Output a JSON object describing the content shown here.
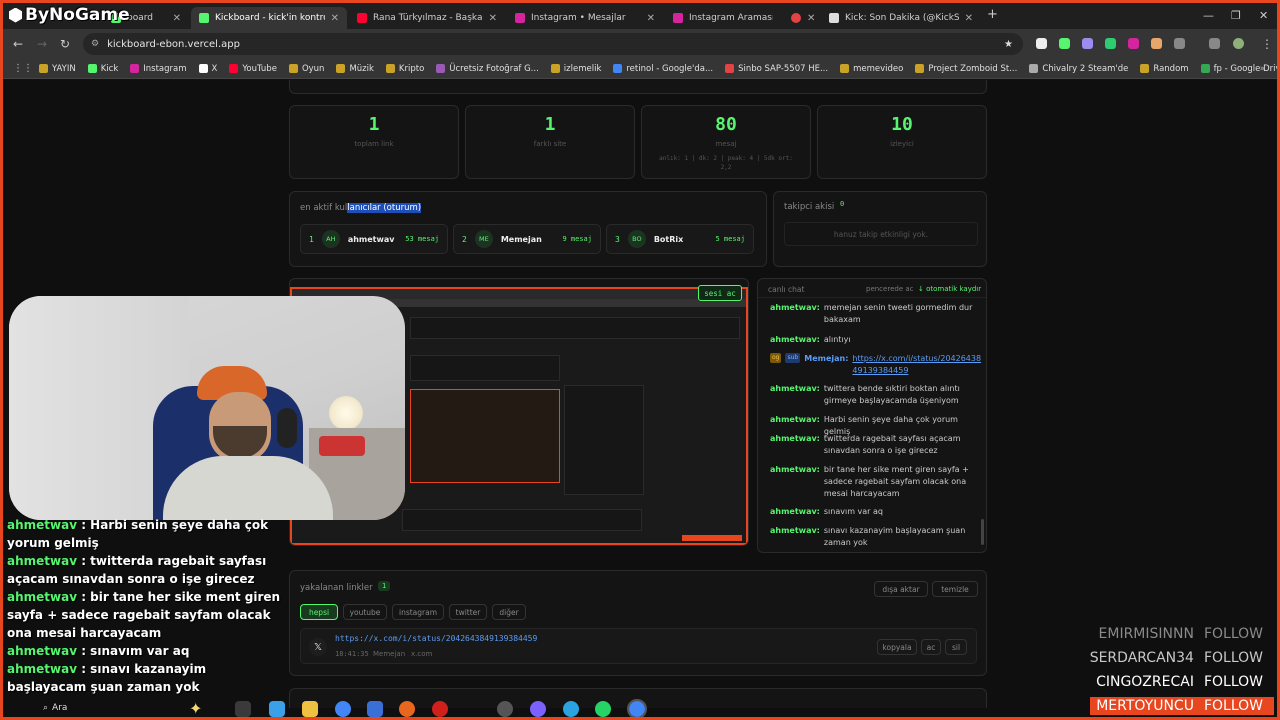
{
  "overlay": {
    "channel_logo": "ByNoGame"
  },
  "tabs": [
    {
      "label": "board",
      "active": false,
      "color": "#56f56f"
    },
    {
      "label": "Kickboard - kick'in kontrol pane",
      "active": true,
      "color": "#56f56f"
    },
    {
      "label": "Rana Türkyılmaz - Başka Hikaye",
      "active": false,
      "color": "#ff0033"
    },
    {
      "label": "Instagram • Mesajlar",
      "active": false,
      "color": "#d6249f"
    },
    {
      "label": "Instagram Araması",
      "active": false,
      "color": "#d6249f"
    },
    {
      "label": "",
      "active": false,
      "color": "#e24444"
    },
    {
      "label": "Kick: Son Dakika (@KickSonDak",
      "active": false,
      "color": "#dddddd"
    }
  ],
  "address": {
    "url": "kickboard-ebon.vercel.app"
  },
  "bookmarks": [
    {
      "label": "YAYIN",
      "color": "#c9a227"
    },
    {
      "label": "Kick",
      "color": "#56f56f"
    },
    {
      "label": "Instagram",
      "color": "#d6249f"
    },
    {
      "label": "X",
      "color": "#ffffff"
    },
    {
      "label": "YouTube",
      "color": "#ff0033"
    },
    {
      "label": "Oyun",
      "color": "#c9a227"
    },
    {
      "label": "Müzik",
      "color": "#c9a227"
    },
    {
      "label": "Kripto",
      "color": "#c9a227"
    },
    {
      "label": "Ücretsiz Fotoğraf G...",
      "color": "#9b59b6"
    },
    {
      "label": "izlemelik",
      "color": "#c9a227"
    },
    {
      "label": "retinol - Google'da...",
      "color": "#4285f4"
    },
    {
      "label": "Sinbo SAP-5507 HE...",
      "color": "#e24444"
    },
    {
      "label": "memevideo",
      "color": "#c9a227"
    },
    {
      "label": "Project Zomboid St...",
      "color": "#c9a227"
    },
    {
      "label": "Chivalry 2 Steam'de",
      "color": "#aaaaaa"
    },
    {
      "label": "Random",
      "color": "#c9a227"
    },
    {
      "label": "fp - Google Drive",
      "color": "#34a853"
    }
  ],
  "stats": [
    {
      "value": "1",
      "label": "toplam link",
      "sub": ""
    },
    {
      "value": "1",
      "label": "farklı site",
      "sub": ""
    },
    {
      "value": "80",
      "label": "mesaj",
      "sub": "anlık: 1 | dk: 2 | peak: 4 | 5dk ort: 2,2"
    },
    {
      "value": "10",
      "label": "izleyici",
      "sub": ""
    }
  ],
  "active_users": {
    "title_prefix": "en aktif kul",
    "title_selected": "lanıcılar (oturum)",
    "users": [
      {
        "rank": "1",
        "initials": "AH",
        "name": "ahmetwav",
        "count": "53 mesaj"
      },
      {
        "rank": "2",
        "initials": "ME",
        "name": "Memejan",
        "count": "9 mesaj"
      },
      {
        "rank": "3",
        "initials": "BO",
        "name": "BotRix",
        "count": "5 mesaj"
      }
    ]
  },
  "followers_panel": {
    "title": "takipci akisi",
    "count": "0",
    "empty": "hanuz takip etkinligi yok."
  },
  "stream_preview": {
    "button": "sesi ac"
  },
  "chat": {
    "title": "canlı chat",
    "popout": "pencerede ac",
    "autoscroll": "↓ otomatik kaydır",
    "messages": [
      {
        "user": "ahmetwav:",
        "text": "memejan senin tweeti gormedim dur bakaxam",
        "link": false
      },
      {
        "user": "ahmetwav:",
        "text": "alıntıyı",
        "link": false
      },
      {
        "user": "Memejan:",
        "text": "https://x.com/i/status/2042643849139384459",
        "link": true,
        "badges": [
          "og",
          "sub"
        ]
      },
      {
        "user": "ahmetwav:",
        "text": "twittera bende sıktiri boktan alıntı girmeye başlayacamda üşeniyom",
        "link": false
      },
      {
        "user": "ahmetwav:",
        "text": "Harbi senin şeye daha çok yorum gelmiş",
        "link": false
      },
      {
        "user": "ahmetwav:",
        "text": "twitterda ragebait sayfası açacam sınavdan sonra o işe girecez",
        "link": false
      },
      {
        "user": "ahmetwav:",
        "text": "bir tane her sike ment giren sayfa + sadece ragebait sayfam olacak ona mesai harcayacam",
        "link": false
      },
      {
        "user": "ahmetwav:",
        "text": "sınavım var aq",
        "link": false
      },
      {
        "user": "ahmetwav:",
        "text": "sınavı kazanayim başlayacam şuan zaman yok",
        "link": false
      }
    ]
  },
  "links": {
    "title": "yakalanan linkler",
    "count": "1",
    "export": "dışa aktar",
    "clear": "temizle",
    "filters": [
      "hepsi",
      "youtube",
      "instagram",
      "twitter",
      "diğer"
    ],
    "rows": [
      {
        "url": "https://x.com/i/status/2042643849139384459",
        "time": "18:41:35",
        "user": "Memejan",
        "site": "x.com",
        "actions": [
          "kopyala",
          "ac",
          "sil"
        ]
      }
    ]
  },
  "overlay_chat": [
    {
      "user": "ahmetwav",
      "text": " : Harbi senin şeye daha çok yorum gelmiş"
    },
    {
      "user": "ahmetwav",
      "text": " : twitterda ragebait sayfası açacam sınavdan sonra o işe girecez"
    },
    {
      "user": "ahmetwav",
      "text": " : bir tane her sike ment giren sayfa + sadece ragebait sayfam olacak ona mesai harcayacam"
    },
    {
      "user": "ahmetwav",
      "text": " : sınavım var aq"
    },
    {
      "user": "ahmetwav",
      "text": " : sınavı kazanayim başlayacam şuan zaman yok"
    }
  ],
  "recent_followers": [
    {
      "name": "EMIRMISINNN",
      "action": "FOLLOW"
    },
    {
      "name": "SERDARCAN34",
      "action": "FOLLOW"
    },
    {
      "name": "CINGOZRECAI",
      "action": "FOLLOW"
    },
    {
      "name": "MERTOYUNCU",
      "action": "FOLLOW"
    }
  ],
  "taskbar": {
    "search_label": "Ara"
  }
}
